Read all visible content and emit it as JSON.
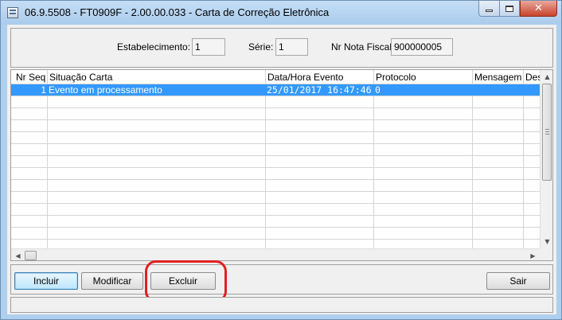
{
  "window": {
    "title": "06.9.5508 - FT0909F - 2.00.00.033 - Carta de Correção Eletrônica",
    "controls": {
      "minimize": "minimize",
      "maximize": "maximize",
      "close": "✕"
    }
  },
  "header": {
    "estabelecimento_label": "Estabelecimento:",
    "estabelecimento_value": "1",
    "serie_label": "Série:",
    "serie_value": "1",
    "nota_label": "Nr Nota Fiscal:",
    "nota_value": "900000005"
  },
  "grid": {
    "columns": [
      "Nr Seq",
      "Situação Carta",
      "Data/Hora Evento",
      "Protocolo",
      "Mensagem",
      "Des"
    ],
    "rows": [
      {
        "seq": "1",
        "situacao": "Evento em processamento",
        "data_hora": "25/01/2017 16:47:46",
        "protocolo": "0",
        "mensagem": "",
        "descricao": ""
      }
    ],
    "selected_row_color": "#3399ff"
  },
  "scrollbars": {
    "up_arrow": "▲",
    "down_arrow": "▼",
    "left_arrow": "◀",
    "right_arrow": "▶"
  },
  "buttons": {
    "incluir": "Incluir",
    "modificar": "Modificar",
    "excluir": "Excluir",
    "sair": "Sair"
  },
  "annotation": {
    "highlight_color": "#e02020",
    "highlighted_button": "Excluir"
  }
}
